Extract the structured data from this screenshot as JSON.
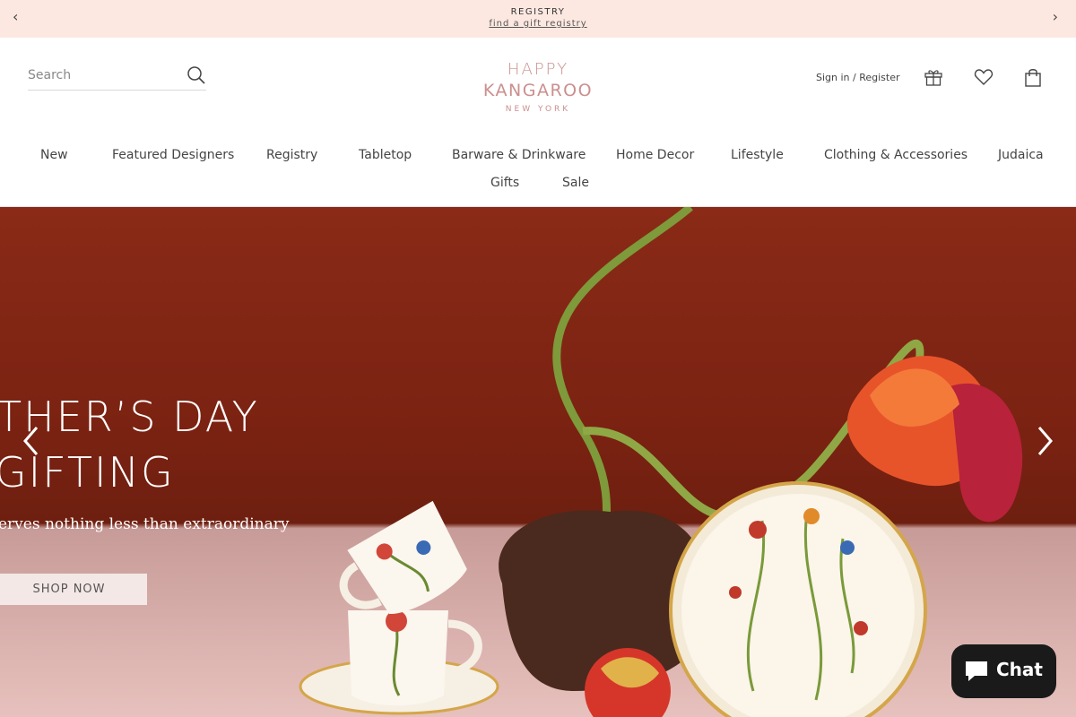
{
  "announcement": {
    "title": "REGISTRY",
    "link": "find a gift registry",
    "prev_glyph": "‹",
    "next_glyph": "›"
  },
  "header": {
    "search_placeholder": "Search",
    "logo": {
      "line1": "HAPPY",
      "line2": "KANGAROO",
      "line3": "NEW YORK"
    },
    "signin": "Sign in / Register",
    "icons": [
      "gift-icon",
      "heart-icon",
      "shopping-bag-icon"
    ]
  },
  "nav": {
    "items": [
      "New",
      "Featured Designers",
      "Registry",
      "Tabletop",
      "Barware & Drinkware",
      "Home Decor",
      "Lifestyle",
      "Clothing & Accessories",
      "Judaica",
      "Gifts",
      "Sale"
    ]
  },
  "hero": {
    "headline_line1": "THER’S DAY",
    "headline_line2": "GIFTING",
    "subtitle": "erves nothing less than extraordinary",
    "cta": "SHOP NOW"
  },
  "chat": {
    "label": "Chat"
  },
  "colors": {
    "announce_bg": "#fde8e1",
    "logo": "#cb8f8f",
    "hero_red": "#7a2212",
    "chat_bg": "#1a1a1a"
  }
}
